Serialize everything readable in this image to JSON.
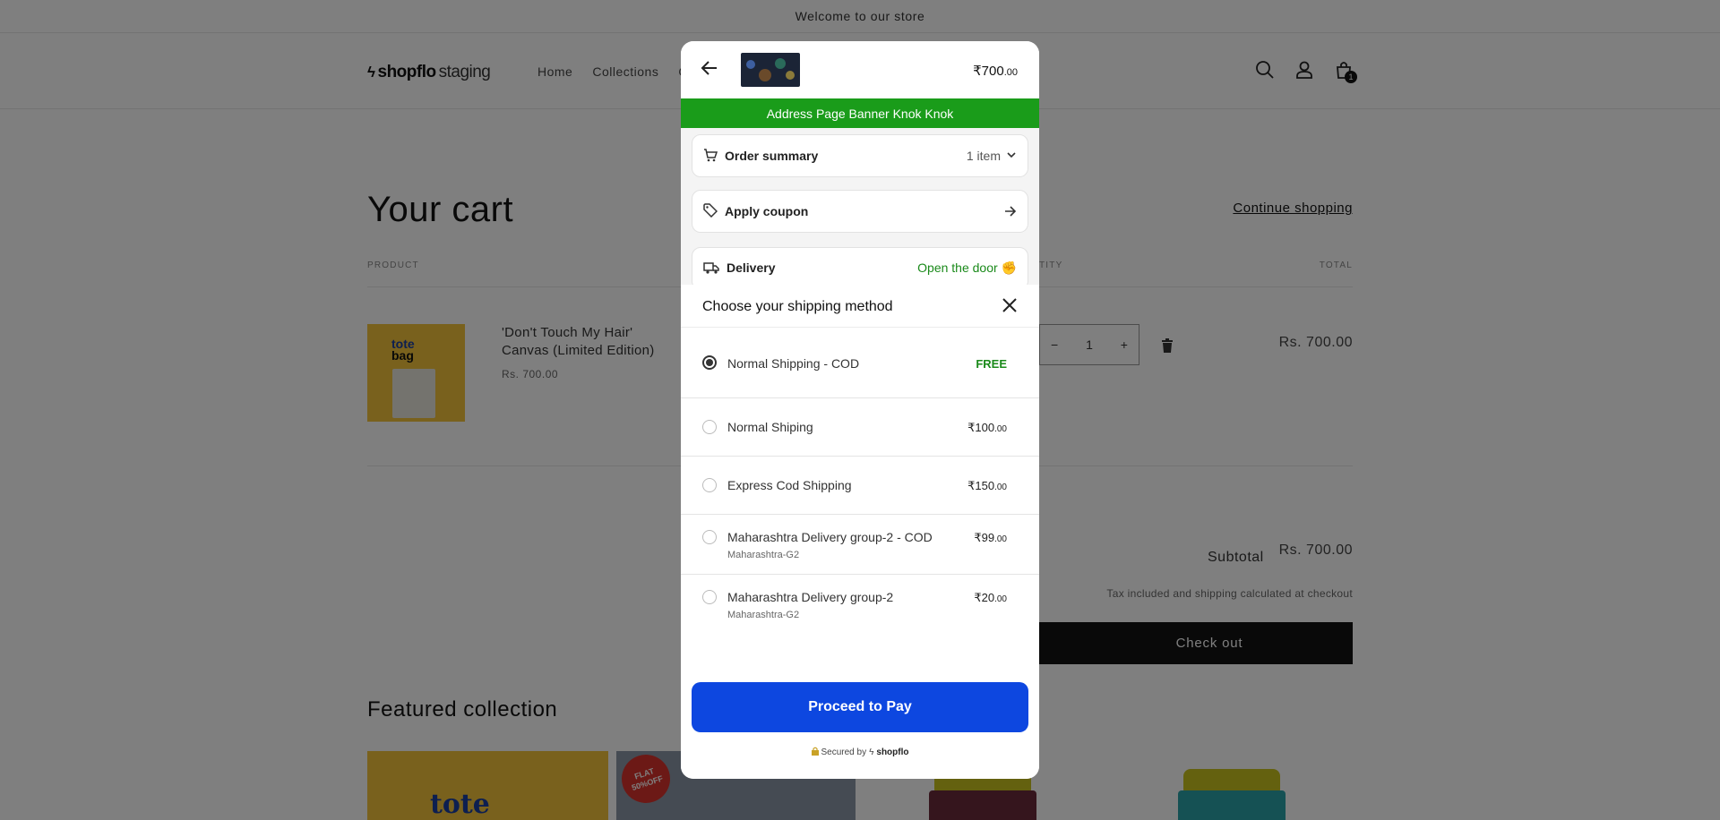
{
  "store": {
    "announcement": "Welcome to our store",
    "logo_brand": "shopflo",
    "logo_suffix": "staging",
    "nav": [
      "Home",
      "Collections",
      "C"
    ],
    "cart_count": "1",
    "cart_title": "Your cart",
    "continue_shopping": "Continue shopping",
    "columns": {
      "product": "PRODUCT",
      "quantity": "TITY",
      "total": "TOTAL"
    },
    "item": {
      "name": "'Don't Touch My Hair' Canvas (Limited Edition)",
      "price": "Rs. 700.00",
      "quantity": "1",
      "line_total": "Rs. 700.00",
      "image_text": [
        "tote",
        "bag",
        "o"
      ]
    },
    "subtotal_label": "Subtotal",
    "subtotal_value": "Rs. 700.00",
    "tax_note": "Tax included and shipping calculated at checkout",
    "checkout_label": "Check out",
    "featured_title": "Featured collection",
    "featured_card1_text": "tote",
    "featured_badge": "FLAT 50%OFF"
  },
  "modal": {
    "price_main": "₹700",
    "price_decimal": ".00",
    "banner": "Address Page Banner Knok Knok",
    "order_summary_label": "Order summary",
    "order_summary_count": "1 item",
    "coupon_label": "Apply coupon",
    "delivery_label": "Delivery",
    "delivery_value": "Open the door ✊",
    "sheet_title": "Choose your shipping method",
    "options": [
      {
        "name": "Normal Shipping - COD",
        "sub": "",
        "cost_main": "FREE",
        "cost_decimal": "",
        "selected": true
      },
      {
        "name": "Normal Shiping",
        "sub": "",
        "cost_main": "₹100",
        "cost_decimal": ".00",
        "selected": false
      },
      {
        "name": "Express Cod Shipping",
        "sub": "",
        "cost_main": "₹150",
        "cost_decimal": ".00",
        "selected": false
      },
      {
        "name": "Maharashtra Delivery group-2 - COD",
        "sub": "Maharashtra-G2",
        "cost_main": "₹99",
        "cost_decimal": ".00",
        "selected": false
      },
      {
        "name": "Maharashtra Delivery group-2",
        "sub": "Maharashtra-G2",
        "cost_main": "₹20",
        "cost_decimal": ".00",
        "selected": false
      }
    ],
    "pay_label": "Proceed to Pay",
    "secured_prefix": "Secured by",
    "secured_brand": "shopflo"
  },
  "colors": {
    "banner_green": "#1a9c1a",
    "pay_blue": "#0d47e0",
    "free_green": "#1a8a1a"
  }
}
